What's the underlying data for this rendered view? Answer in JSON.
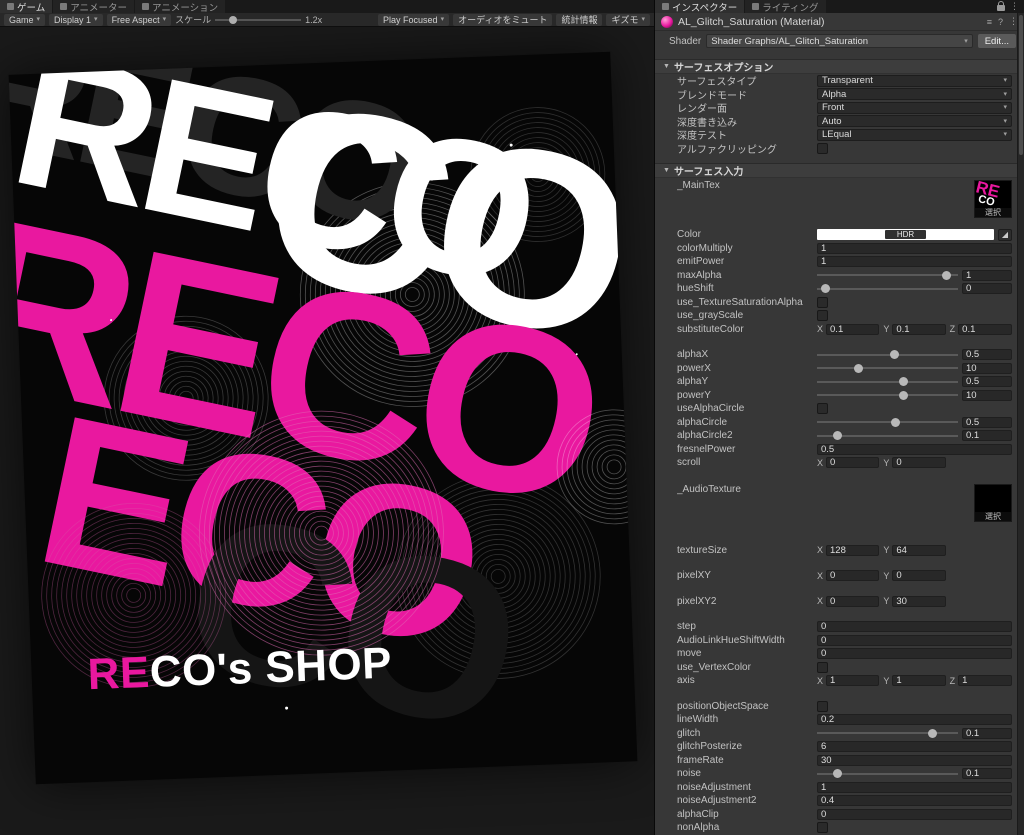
{
  "accent": "#e9189f",
  "top_left_tabs": [
    {
      "label": "ゲーム",
      "active": true
    },
    {
      "label": "アニメーター",
      "active": false
    },
    {
      "label": "アニメーション",
      "active": false
    }
  ],
  "game_toolbar": {
    "game": "Game",
    "display": "Display 1",
    "aspect": "Free Aspect",
    "scale_label": "スケール",
    "scale_value": "1.2x",
    "play_focused": "Play Focused",
    "mute": "オーディオをミュート",
    "stats": "統計情報",
    "gizmos": "ギズモ"
  },
  "inspector_tabs": [
    {
      "label": "インスペクター",
      "active": true
    },
    {
      "label": "ライティング",
      "active": false
    }
  ],
  "material": {
    "title": "AL_Glitch_Saturation (Material)",
    "shader_label": "Shader",
    "shader_value": "Shader Graphs/AL_Glitch_Saturation",
    "edit": "Edit..."
  },
  "game_art": {
    "title_accent": "RE",
    "title_rest": "CO's SHOP",
    "layers": [
      {
        "text": "RECO",
        "color": "#242424"
      },
      {
        "text": "RECO",
        "color": "#ffffff"
      },
      {
        "text": "CO",
        "color": "#ffffff"
      },
      {
        "text": "RECO",
        "color": "#e9189f"
      },
      {
        "text": "ECO",
        "color": "#e9189f"
      },
      {
        "text": "CO",
        "color": "#151515"
      }
    ]
  },
  "inspector": {
    "rows": [
      {
        "type": "header",
        "label": "サーフェスオプション"
      },
      {
        "type": "dropdown",
        "label": "サーフェスタイプ",
        "value": "Transparent"
      },
      {
        "type": "dropdown",
        "label": "ブレンドモード",
        "value": "Alpha"
      },
      {
        "type": "dropdown",
        "label": "レンダー面",
        "value": "Front"
      },
      {
        "type": "dropdown",
        "label": "深度書き込み",
        "value": "Auto"
      },
      {
        "type": "dropdown",
        "label": "深度テスト",
        "value": "LEqual"
      },
      {
        "type": "checkbox",
        "label": "アルファクリッピング",
        "checked": false
      },
      {
        "type": "header",
        "label": "サーフェス入力"
      },
      {
        "type": "texture",
        "label": "_MainTex",
        "thumb": "main",
        "select": "選択"
      },
      {
        "type": "color",
        "label": "Color",
        "badge": "HDR"
      },
      {
        "type": "field",
        "label": "colorMultiply",
        "value": "1"
      },
      {
        "type": "field",
        "label": "emitPower",
        "value": "1"
      },
      {
        "type": "slider",
        "label": "maxAlpha",
        "pos": 0.95,
        "value": "1"
      },
      {
        "type": "slider",
        "label": "hueShift",
        "pos": 0.03,
        "value": "0"
      },
      {
        "type": "checkbox",
        "label": "use_TextureSaturationAlpha",
        "checked": false
      },
      {
        "type": "checkbox",
        "label": "use_grayScale",
        "checked": false
      },
      {
        "type": "vector",
        "label": "substituteColor",
        "comps": [
          [
            "X",
            "0.1"
          ],
          [
            "Y",
            "0.1"
          ],
          [
            "Z",
            "0.1"
          ]
        ]
      },
      {
        "type": "gap"
      },
      {
        "type": "slider",
        "label": "alphaX",
        "pos": 0.55,
        "value": "0.5"
      },
      {
        "type": "slider",
        "label": "powerX",
        "pos": 0.28,
        "value": "10"
      },
      {
        "type": "slider",
        "label": "alphaY",
        "pos": 0.62,
        "value": "0.5"
      },
      {
        "type": "slider",
        "label": "powerY",
        "pos": 0.62,
        "value": "10"
      },
      {
        "type": "checkbox",
        "label": "useAlphaCircle",
        "checked": false
      },
      {
        "type": "slider",
        "label": "alphaCircle",
        "pos": 0.56,
        "value": "0.5"
      },
      {
        "type": "slider",
        "label": "alphaCircle2",
        "pos": 0.12,
        "value": "0.1"
      },
      {
        "type": "field",
        "label": "fresnelPower",
        "value": "0.5"
      },
      {
        "type": "vector",
        "label": "scroll",
        "comps": [
          [
            "X",
            "0"
          ],
          [
            "Y",
            "0"
          ]
        ]
      },
      {
        "type": "gap"
      },
      {
        "type": "texture",
        "label": "_AudioTexture",
        "thumb": "audio",
        "select": "選択"
      },
      {
        "type": "gap"
      },
      {
        "type": "vector",
        "label": "textureSize",
        "comps": [
          [
            "X",
            "128"
          ],
          [
            "Y",
            "64"
          ]
        ]
      },
      {
        "type": "gap"
      },
      {
        "type": "vector",
        "label": "pixelXY",
        "comps": [
          [
            "X",
            "0"
          ],
          [
            "Y",
            "0"
          ]
        ]
      },
      {
        "type": "gap"
      },
      {
        "type": "vector",
        "label": "pixelXY2",
        "comps": [
          [
            "X",
            "0"
          ],
          [
            "Y",
            "30"
          ]
        ]
      },
      {
        "type": "gap"
      },
      {
        "type": "field",
        "label": "step",
        "value": "0"
      },
      {
        "type": "field",
        "label": "AudioLinkHueShiftWidth",
        "value": "0"
      },
      {
        "type": "field",
        "label": "move",
        "value": "0"
      },
      {
        "type": "checkbox",
        "label": "use_VertexColor",
        "checked": false
      },
      {
        "type": "vector",
        "label": "axis",
        "comps": [
          [
            "X",
            "1"
          ],
          [
            "Y",
            "1"
          ],
          [
            "Z",
            "1"
          ]
        ]
      },
      {
        "type": "gap"
      },
      {
        "type": "checkbox",
        "label": "positionObjectSpace",
        "checked": false
      },
      {
        "type": "field",
        "label": "lineWidth",
        "value": "0.2"
      },
      {
        "type": "slider",
        "label": "glitch",
        "pos": 0.84,
        "value": "0.1"
      },
      {
        "type": "field",
        "label": "glitchPosterize",
        "value": "6"
      },
      {
        "type": "field",
        "label": "frameRate",
        "value": "30"
      },
      {
        "type": "slider",
        "label": "noise",
        "pos": 0.12,
        "value": "0.1"
      },
      {
        "type": "field",
        "label": "noiseAdjustment",
        "value": "1"
      },
      {
        "type": "field",
        "label": "noiseAdjustment2",
        "value": "0.4"
      },
      {
        "type": "field",
        "label": "alphaClip",
        "value": "0"
      },
      {
        "type": "checkbox",
        "label": "nonAlpha",
        "checked": false
      }
    ]
  }
}
